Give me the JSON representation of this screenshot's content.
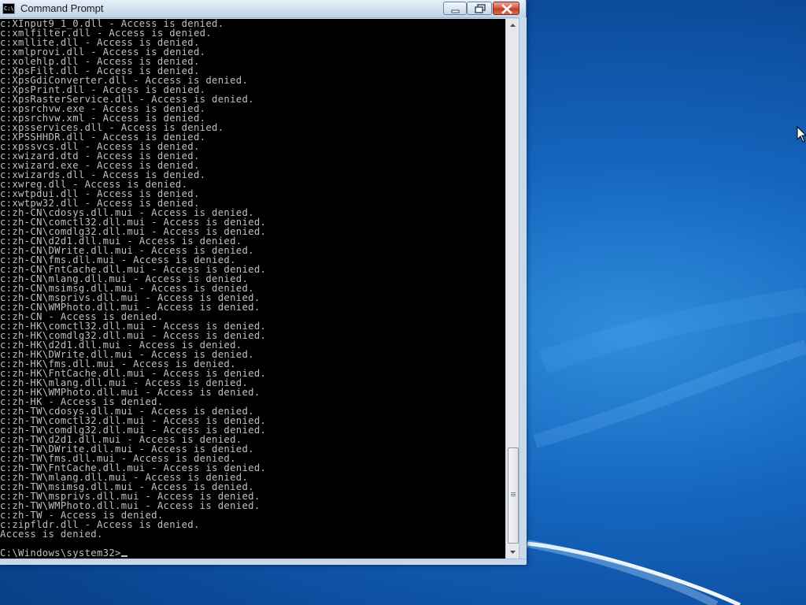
{
  "window": {
    "title": "Command Prompt",
    "icon": "cmd-icon",
    "controls": {
      "minimize": "minimize-icon",
      "maximize": "restore-icon",
      "close": "close-icon"
    }
  },
  "console": {
    "lines": [
      "c:XInput9_1_0.dll - Access is denied.",
      "c:xmlfilter.dll - Access is denied.",
      "c:xmllite.dll - Access is denied.",
      "c:xmlprovi.dll - Access is denied.",
      "c:xolehlp.dll - Access is denied.",
      "c:XpsFilt.dll - Access is denied.",
      "c:XpsGdiConverter.dll - Access is denied.",
      "c:XpsPrint.dll - Access is denied.",
      "c:XpsRasterService.dll - Access is denied.",
      "c:xpsrchvw.exe - Access is denied.",
      "c:xpsrchvw.xml - Access is denied.",
      "c:xpsservices.dll - Access is denied.",
      "c:XPSSHHDR.dll - Access is denied.",
      "c:xpssvcs.dll - Access is denied.",
      "c:xwizard.dtd - Access is denied.",
      "c:xwizard.exe - Access is denied.",
      "c:xwizards.dll - Access is denied.",
      "c:xwreg.dll - Access is denied.",
      "c:xwtpdui.dll - Access is denied.",
      "c:xwtpw32.dll - Access is denied.",
      "c:zh-CN\\cdosys.dll.mui - Access is denied.",
      "c:zh-CN\\comctl32.dll.mui - Access is denied.",
      "c:zh-CN\\comdlg32.dll.mui - Access is denied.",
      "c:zh-CN\\d2d1.dll.mui - Access is denied.",
      "c:zh-CN\\DWrite.dll.mui - Access is denied.",
      "c:zh-CN\\fms.dll.mui - Access is denied.",
      "c:zh-CN\\FntCache.dll.mui - Access is denied.",
      "c:zh-CN\\mlang.dll.mui - Access is denied.",
      "c:zh-CN\\msimsg.dll.mui - Access is denied.",
      "c:zh-CN\\msprivs.dll.mui - Access is denied.",
      "c:zh-CN\\WMPhoto.dll.mui - Access is denied.",
      "c:zh-CN - Access is denied.",
      "c:zh-HK\\comctl32.dll.mui - Access is denied.",
      "c:zh-HK\\comdlg32.dll.mui - Access is denied.",
      "c:zh-HK\\d2d1.dll.mui - Access is denied.",
      "c:zh-HK\\DWrite.dll.mui - Access is denied.",
      "c:zh-HK\\fms.dll.mui - Access is denied.",
      "c:zh-HK\\FntCache.dll.mui - Access is denied.",
      "c:zh-HK\\mlang.dll.mui - Access is denied.",
      "c:zh-HK\\WMPhoto.dll.mui - Access is denied.",
      "c:zh-HK - Access is denied.",
      "c:zh-TW\\cdosys.dll.mui - Access is denied.",
      "c:zh-TW\\comctl32.dll.mui - Access is denied.",
      "c:zh-TW\\comdlg32.dll.mui - Access is denied.",
      "c:zh-TW\\d2d1.dll.mui - Access is denied.",
      "c:zh-TW\\DWrite.dll.mui - Access is denied.",
      "c:zh-TW\\fms.dll.mui - Access is denied.",
      "c:zh-TW\\FntCache.dll.mui - Access is denied.",
      "c:zh-TW\\mlang.dll.mui - Access is denied.",
      "c:zh-TW\\msimsg.dll.mui - Access is denied.",
      "c:zh-TW\\msprivs.dll.mui - Access is denied.",
      "c:zh-TW\\WMPhoto.dll.mui - Access is denied.",
      "c:zh-TW - Access is denied.",
      "c:zipfldr.dll - Access is denied.",
      "Access is denied.",
      ""
    ],
    "prompt": "C:\\Windows\\system32>"
  },
  "desktop": {
    "cursor": "mouse-pointer-icon"
  },
  "colors": {
    "console_bg": "#000000",
    "console_fg": "#c0c0c0",
    "desktop_bg": "#1566bf"
  }
}
